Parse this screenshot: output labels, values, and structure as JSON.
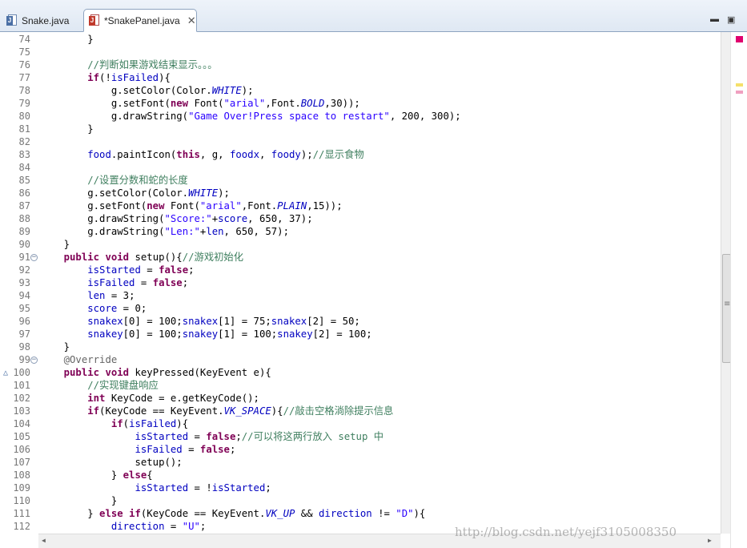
{
  "tabs": [
    {
      "label": "Snake.java",
      "active": false
    },
    {
      "label": "*SnakePanel.java",
      "active": true,
      "close": "✕"
    }
  ],
  "window_buttons": {
    "minimize": "▬",
    "maximize": "▣"
  },
  "editor": {
    "lines": [
      {
        "n": "74",
        "code": [
          {
            "t": "        }"
          }
        ]
      },
      {
        "n": "75",
        "code": []
      },
      {
        "n": "76",
        "code": [
          {
            "t": "        "
          },
          {
            "t": "//判断如果游戏结束显示。。。",
            "c": "c"
          }
        ]
      },
      {
        "n": "77",
        "code": [
          {
            "t": "        "
          },
          {
            "t": "if",
            "c": "k"
          },
          {
            "t": "(!"
          },
          {
            "t": "isFailed",
            "c": "f"
          },
          {
            "t": "){"
          }
        ]
      },
      {
        "n": "78",
        "code": [
          {
            "t": "            g.setColor(Color."
          },
          {
            "t": "WHITE",
            "c": "fi"
          },
          {
            "t": ");"
          }
        ]
      },
      {
        "n": "79",
        "code": [
          {
            "t": "            g.setFont("
          },
          {
            "t": "new",
            "c": "k"
          },
          {
            "t": " Font("
          },
          {
            "t": "\"arial\"",
            "c": "s"
          },
          {
            "t": ",Font."
          },
          {
            "t": "BOLD",
            "c": "fi"
          },
          {
            "t": ",30));"
          }
        ]
      },
      {
        "n": "80",
        "code": [
          {
            "t": "            g.drawString("
          },
          {
            "t": "\"Game Over!Press space to restart\"",
            "c": "s"
          },
          {
            "t": ", 200, 300);"
          }
        ]
      },
      {
        "n": "81",
        "code": [
          {
            "t": "        }"
          }
        ]
      },
      {
        "n": "82",
        "code": []
      },
      {
        "n": "83",
        "code": [
          {
            "t": "        "
          },
          {
            "t": "food",
            "c": "f"
          },
          {
            "t": ".paintIcon("
          },
          {
            "t": "this",
            "c": "k"
          },
          {
            "t": ", g, "
          },
          {
            "t": "foodx",
            "c": "f"
          },
          {
            "t": ", "
          },
          {
            "t": "foody",
            "c": "f"
          },
          {
            "t": ");"
          },
          {
            "t": "//显示食物",
            "c": "c"
          }
        ]
      },
      {
        "n": "84",
        "code": []
      },
      {
        "n": "85",
        "code": [
          {
            "t": "        "
          },
          {
            "t": "//设置分数和蛇的长度",
            "c": "c"
          }
        ]
      },
      {
        "n": "86",
        "code": [
          {
            "t": "        g.setColor(Color."
          },
          {
            "t": "WHITE",
            "c": "fi"
          },
          {
            "t": ");"
          }
        ]
      },
      {
        "n": "87",
        "code": [
          {
            "t": "        g.setFont("
          },
          {
            "t": "new",
            "c": "k"
          },
          {
            "t": " Font("
          },
          {
            "t": "\"arial\"",
            "c": "s"
          },
          {
            "t": ",Font."
          },
          {
            "t": "PLAIN",
            "c": "fi"
          },
          {
            "t": ",15));"
          }
        ]
      },
      {
        "n": "88",
        "code": [
          {
            "t": "        g.drawString("
          },
          {
            "t": "\"Score:\"",
            "c": "s"
          },
          {
            "t": "+"
          },
          {
            "t": "score",
            "c": "f"
          },
          {
            "t": ", 650, 37);"
          }
        ]
      },
      {
        "n": "89",
        "code": [
          {
            "t": "        g.drawString("
          },
          {
            "t": "\"Len:\"",
            "c": "s"
          },
          {
            "t": "+"
          },
          {
            "t": "len",
            "c": "f"
          },
          {
            "t": ", 650, 57);"
          }
        ]
      },
      {
        "n": "90",
        "code": [
          {
            "t": "    }"
          }
        ]
      },
      {
        "n": "91",
        "fold": "⊖",
        "code": [
          {
            "t": "    "
          },
          {
            "t": "public",
            "c": "k"
          },
          {
            "t": " "
          },
          {
            "t": "void",
            "c": "k"
          },
          {
            "t": " setup(){"
          },
          {
            "t": "//游戏初始化",
            "c": "c"
          }
        ]
      },
      {
        "n": "92",
        "code": [
          {
            "t": "        "
          },
          {
            "t": "isStarted",
            "c": "f"
          },
          {
            "t": " = "
          },
          {
            "t": "false",
            "c": "k"
          },
          {
            "t": ";"
          }
        ]
      },
      {
        "n": "93",
        "code": [
          {
            "t": "        "
          },
          {
            "t": "isFailed",
            "c": "f"
          },
          {
            "t": " = "
          },
          {
            "t": "false",
            "c": "k"
          },
          {
            "t": ";"
          }
        ]
      },
      {
        "n": "94",
        "code": [
          {
            "t": "        "
          },
          {
            "t": "len",
            "c": "f"
          },
          {
            "t": " = 3;"
          }
        ]
      },
      {
        "n": "95",
        "code": [
          {
            "t": "        "
          },
          {
            "t": "score",
            "c": "f"
          },
          {
            "t": " = 0;"
          }
        ]
      },
      {
        "n": "96",
        "code": [
          {
            "t": "        "
          },
          {
            "t": "snakex",
            "c": "f"
          },
          {
            "t": "[0] = 100;"
          },
          {
            "t": "snakex",
            "c": "f"
          },
          {
            "t": "[1] = 75;"
          },
          {
            "t": "snakex",
            "c": "f"
          },
          {
            "t": "[2] = 50;"
          }
        ]
      },
      {
        "n": "97",
        "code": [
          {
            "t": "        "
          },
          {
            "t": "snakey",
            "c": "f"
          },
          {
            "t": "[0] = 100;"
          },
          {
            "t": "snakey",
            "c": "f"
          },
          {
            "t": "[1] = 100;"
          },
          {
            "t": "snakey",
            "c": "f"
          },
          {
            "t": "[2] = 100;"
          }
        ]
      },
      {
        "n": "98",
        "code": [
          {
            "t": "    }"
          }
        ]
      },
      {
        "n": "99",
        "fold": "⊖",
        "code": [
          {
            "t": "    "
          },
          {
            "t": "@Override",
            "c": "a"
          }
        ]
      },
      {
        "n": "100",
        "override": "△",
        "code": [
          {
            "t": "    "
          },
          {
            "t": "public",
            "c": "k"
          },
          {
            "t": " "
          },
          {
            "t": "void",
            "c": "k"
          },
          {
            "t": " keyPressed(KeyEvent e){"
          }
        ]
      },
      {
        "n": "101",
        "code": [
          {
            "t": "        "
          },
          {
            "t": "//实现键盘响应",
            "c": "c"
          }
        ]
      },
      {
        "n": "102",
        "code": [
          {
            "t": "        "
          },
          {
            "t": "int",
            "c": "k"
          },
          {
            "t": " KeyCode = e.getKeyCode();"
          }
        ]
      },
      {
        "n": "103",
        "code": [
          {
            "t": "        "
          },
          {
            "t": "if",
            "c": "k"
          },
          {
            "t": "(KeyCode == KeyEvent."
          },
          {
            "t": "VK_SPACE",
            "c": "fi"
          },
          {
            "t": "){"
          },
          {
            "t": "//敲击空格淌除提示信息",
            "c": "c"
          }
        ]
      },
      {
        "n": "104",
        "code": [
          {
            "t": "            "
          },
          {
            "t": "if",
            "c": "k"
          },
          {
            "t": "("
          },
          {
            "t": "isFailed",
            "c": "f"
          },
          {
            "t": "){"
          }
        ]
      },
      {
        "n": "105",
        "code": [
          {
            "t": "                "
          },
          {
            "t": "isStarted",
            "c": "f"
          },
          {
            "t": " = "
          },
          {
            "t": "false",
            "c": "k"
          },
          {
            "t": ";"
          },
          {
            "t": "//可以将这两行放入 setup 中",
            "c": "c"
          }
        ]
      },
      {
        "n": "106",
        "code": [
          {
            "t": "                "
          },
          {
            "t": "isFailed",
            "c": "f"
          },
          {
            "t": " = "
          },
          {
            "t": "false",
            "c": "k"
          },
          {
            "t": ";"
          }
        ]
      },
      {
        "n": "107",
        "code": [
          {
            "t": "                setup();"
          }
        ]
      },
      {
        "n": "108",
        "code": [
          {
            "t": "            } "
          },
          {
            "t": "else",
            "c": "k"
          },
          {
            "t": "{"
          }
        ]
      },
      {
        "n": "109",
        "code": [
          {
            "t": "                "
          },
          {
            "t": "isStarted",
            "c": "f"
          },
          {
            "t": " = !"
          },
          {
            "t": "isStarted",
            "c": "f"
          },
          {
            "t": ";"
          }
        ]
      },
      {
        "n": "110",
        "code": [
          {
            "t": "            }"
          }
        ]
      },
      {
        "n": "111",
        "code": [
          {
            "t": "        } "
          },
          {
            "t": "else",
            "c": "k"
          },
          {
            "t": " "
          },
          {
            "t": "if",
            "c": "k"
          },
          {
            "t": "(KeyCode == KeyEvent."
          },
          {
            "t": "VK_UP",
            "c": "fi"
          },
          {
            "t": " && "
          },
          {
            "t": "direction",
            "c": "f"
          },
          {
            "t": " != "
          },
          {
            "t": "\"D\"",
            "c": "s"
          },
          {
            "t": "){"
          }
        ]
      },
      {
        "n": "112",
        "code": [
          {
            "t": "            "
          },
          {
            "t": "direction",
            "c": "f"
          },
          {
            "t": " = "
          },
          {
            "t": "\"U\"",
            "c": "s"
          },
          {
            "t": ";"
          }
        ]
      }
    ]
  },
  "ruler_marks": [
    {
      "color": "#e0006e"
    },
    {
      "color": "#f5e06a"
    },
    {
      "color": "#f0a0c0"
    }
  ],
  "scrollbar": {
    "grip": "≡",
    "left_arrow": "◀",
    "right_arrow": "▶"
  },
  "watermark": "http://blog.csdn.net/yejf3105008350"
}
